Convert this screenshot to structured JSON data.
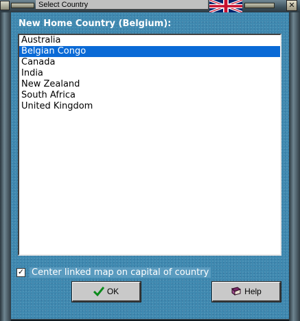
{
  "window": {
    "title": "Select Country"
  },
  "heading": "New Home Country (Belgium):",
  "countries": [
    "Australia",
    "Belgian Congo",
    "Canada",
    "India",
    "New Zealand",
    "South Africa",
    "United Kingdom"
  ],
  "selected_index": 1,
  "center_map": {
    "label": "Center linked map on capital of country",
    "checked": true
  },
  "buttons": {
    "ok": "OK",
    "help": "Help"
  },
  "colors": {
    "panel": "#3f89b0",
    "selection": "#0a6ad6"
  },
  "icons": {
    "ok": "checkmark-icon",
    "help": "book-icon",
    "close": "close-icon",
    "flag": "uk-flag-icon"
  }
}
